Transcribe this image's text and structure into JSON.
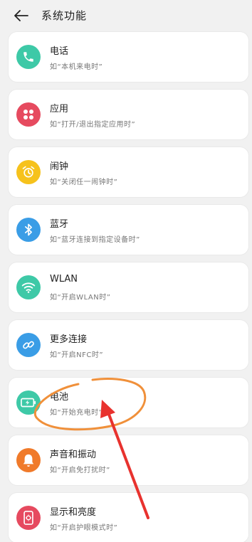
{
  "header": {
    "title": "系统功能",
    "back_icon": "back-arrow-icon"
  },
  "items": [
    {
      "label": "电话",
      "hint": "如“本机来电时”",
      "icon": "phone-icon",
      "color": "#3ec9a7"
    },
    {
      "label": "应用",
      "hint": "如“打开/退出指定应用时”",
      "icon": "apps-grid-icon",
      "color": "#e64a5f"
    },
    {
      "label": "闹钟",
      "hint": "如“关闭任一闹钟时”",
      "icon": "alarm-clock-icon",
      "color": "#f6c21c"
    },
    {
      "label": "蓝牙",
      "hint": "如“蓝牙连接到指定设备时”",
      "icon": "bluetooth-icon",
      "color": "#3a9de6"
    },
    {
      "label": "WLAN",
      "hint": "如“开启WLAN时”",
      "icon": "wifi-icon",
      "color": "#3ec9a7"
    },
    {
      "label": "更多连接",
      "hint": "如“开启NFC时”",
      "icon": "link-icon",
      "color": "#3a9de6"
    },
    {
      "label": "电池",
      "hint": "如“开始充电时”",
      "icon": "battery-charging-icon",
      "color": "#3ec9a7"
    },
    {
      "label": "声音和振动",
      "hint": "如“开启免打扰时”",
      "icon": "bell-icon",
      "color": "#f07a2a"
    },
    {
      "label": "显示和亮度",
      "hint": "如“开启护眼模式时”",
      "icon": "phone-display-icon",
      "color": "#e64a5f"
    }
  ],
  "annotation": {
    "circle_color": "#f0903a",
    "arrow_color": "#e8322e"
  }
}
